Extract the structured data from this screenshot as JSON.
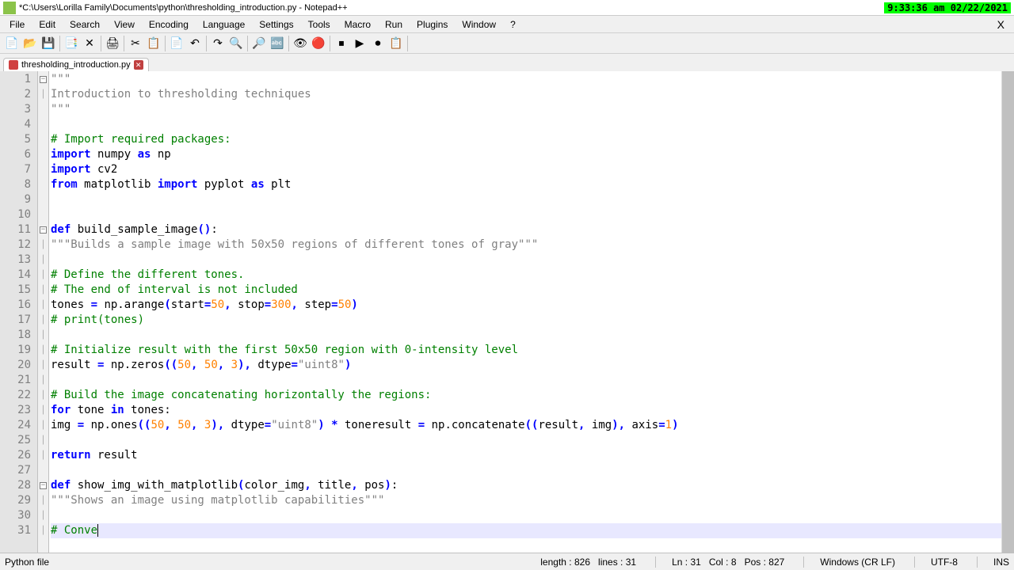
{
  "title": "*C:\\Users\\Lorilla Family\\Documents\\python\\thresholding_introduction.py - Notepad++",
  "timestamp": "9:33:36 am 02/22/2021",
  "menu": [
    "File",
    "Edit",
    "Search",
    "View",
    "Encoding",
    "Language",
    "Settings",
    "Tools",
    "Macro",
    "Run",
    "Plugins",
    "Window",
    "?"
  ],
  "close": "X",
  "tab_name": "thresholding_introduction.py",
  "code_lines": [
    {
      "n": 1,
      "fold": "box",
      "seg": [
        {
          "c": "str",
          "t": "\"\"\""
        }
      ]
    },
    {
      "n": 2,
      "fold": "line",
      "seg": [
        {
          "c": "str",
          "t": "Introduction to thresholding techniques"
        }
      ]
    },
    {
      "n": 3,
      "fold": "",
      "seg": [
        {
          "c": "str",
          "t": "\"\"\""
        }
      ]
    },
    {
      "n": 4,
      "fold": "",
      "seg": []
    },
    {
      "n": 5,
      "fold": "",
      "seg": [
        {
          "c": "cmt",
          "t": "# Import required packages:"
        }
      ]
    },
    {
      "n": 6,
      "fold": "",
      "seg": [
        {
          "c": "kw",
          "t": "import"
        },
        {
          "c": "fn",
          "t": " numpy "
        },
        {
          "c": "kw",
          "t": "as"
        },
        {
          "c": "fn",
          "t": " np"
        }
      ]
    },
    {
      "n": 7,
      "fold": "",
      "seg": [
        {
          "c": "kw",
          "t": "import"
        },
        {
          "c": "fn",
          "t": " cv2"
        }
      ]
    },
    {
      "n": 8,
      "fold": "",
      "seg": [
        {
          "c": "kw",
          "t": "from"
        },
        {
          "c": "fn",
          "t": " matplotlib "
        },
        {
          "c": "kw",
          "t": "import"
        },
        {
          "c": "fn",
          "t": " pyplot "
        },
        {
          "c": "kw",
          "t": "as"
        },
        {
          "c": "fn",
          "t": " plt"
        }
      ]
    },
    {
      "n": 9,
      "fold": "",
      "seg": []
    },
    {
      "n": 10,
      "fold": "",
      "seg": []
    },
    {
      "n": 11,
      "fold": "box",
      "seg": [
        {
          "c": "kw",
          "t": "def"
        },
        {
          "c": "fn",
          "t": " build_sample_image"
        },
        {
          "c": "kw",
          "t": "()"
        },
        {
          "c": "fn",
          "t": ":"
        }
      ]
    },
    {
      "n": 12,
      "fold": "line",
      "seg": [
        {
          "c": "str",
          "t": "\"\"\"Builds a sample image with 50x50 regions of different tones of gray\"\"\""
        }
      ]
    },
    {
      "n": 13,
      "fold": "line",
      "seg": []
    },
    {
      "n": 14,
      "fold": "line",
      "seg": [
        {
          "c": "cmt",
          "t": "# Define the different tones."
        }
      ]
    },
    {
      "n": 15,
      "fold": "line",
      "seg": [
        {
          "c": "cmt",
          "t": "# The end of interval is not included"
        }
      ]
    },
    {
      "n": 16,
      "fold": "line",
      "seg": [
        {
          "c": "fn",
          "t": "tones "
        },
        {
          "c": "kw",
          "t": "="
        },
        {
          "c": "fn",
          "t": " np.arange"
        },
        {
          "c": "kw",
          "t": "("
        },
        {
          "c": "fn",
          "t": "start"
        },
        {
          "c": "kw",
          "t": "="
        },
        {
          "c": "num",
          "t": "50"
        },
        {
          "c": "kw",
          "t": ","
        },
        {
          "c": "fn",
          "t": " stop"
        },
        {
          "c": "kw",
          "t": "="
        },
        {
          "c": "num",
          "t": "300"
        },
        {
          "c": "kw",
          "t": ","
        },
        {
          "c": "fn",
          "t": " step"
        },
        {
          "c": "kw",
          "t": "="
        },
        {
          "c": "num",
          "t": "50"
        },
        {
          "c": "kw",
          "t": ")"
        }
      ]
    },
    {
      "n": 17,
      "fold": "line",
      "seg": [
        {
          "c": "cmt",
          "t": "# print(tones)"
        }
      ]
    },
    {
      "n": 18,
      "fold": "line",
      "seg": []
    },
    {
      "n": 19,
      "fold": "line",
      "seg": [
        {
          "c": "cmt",
          "t": "# Initialize result with the first 50x50 region with 0-intensity level"
        }
      ]
    },
    {
      "n": 20,
      "fold": "line",
      "seg": [
        {
          "c": "fn",
          "t": "result "
        },
        {
          "c": "kw",
          "t": "="
        },
        {
          "c": "fn",
          "t": " np.zeros"
        },
        {
          "c": "kw",
          "t": "(("
        },
        {
          "c": "num",
          "t": "50"
        },
        {
          "c": "kw",
          "t": ","
        },
        {
          "c": "fn",
          "t": " "
        },
        {
          "c": "num",
          "t": "50"
        },
        {
          "c": "kw",
          "t": ","
        },
        {
          "c": "fn",
          "t": " "
        },
        {
          "c": "num",
          "t": "3"
        },
        {
          "c": "kw",
          "t": "),"
        },
        {
          "c": "fn",
          "t": " dtype"
        },
        {
          "c": "kw",
          "t": "="
        },
        {
          "c": "str",
          "t": "\"uint8\""
        },
        {
          "c": "kw",
          "t": ")"
        }
      ]
    },
    {
      "n": 21,
      "fold": "line",
      "seg": []
    },
    {
      "n": 22,
      "fold": "line",
      "seg": [
        {
          "c": "cmt",
          "t": "# Build the image concatenating horizontally the regions:"
        }
      ]
    },
    {
      "n": 23,
      "fold": "line",
      "seg": [
        {
          "c": "kw",
          "t": "for"
        },
        {
          "c": "fn",
          "t": " tone "
        },
        {
          "c": "kw",
          "t": "in"
        },
        {
          "c": "fn",
          "t": " tones:"
        }
      ]
    },
    {
      "n": 24,
      "fold": "line",
      "seg": [
        {
          "c": "fn",
          "t": "img "
        },
        {
          "c": "kw",
          "t": "="
        },
        {
          "c": "fn",
          "t": " np.ones"
        },
        {
          "c": "kw",
          "t": "(("
        },
        {
          "c": "num",
          "t": "50"
        },
        {
          "c": "kw",
          "t": ","
        },
        {
          "c": "fn",
          "t": " "
        },
        {
          "c": "num",
          "t": "50"
        },
        {
          "c": "kw",
          "t": ","
        },
        {
          "c": "fn",
          "t": " "
        },
        {
          "c": "num",
          "t": "3"
        },
        {
          "c": "kw",
          "t": "),"
        },
        {
          "c": "fn",
          "t": " dtype"
        },
        {
          "c": "kw",
          "t": "="
        },
        {
          "c": "str",
          "t": "\"uint8\""
        },
        {
          "c": "kw",
          "t": ")"
        },
        {
          "c": "fn",
          "t": " "
        },
        {
          "c": "kw",
          "t": "*"
        },
        {
          "c": "fn",
          "t": " toneresult "
        },
        {
          "c": "kw",
          "t": "="
        },
        {
          "c": "fn",
          "t": " np.concatenate"
        },
        {
          "c": "kw",
          "t": "(("
        },
        {
          "c": "fn",
          "t": "result"
        },
        {
          "c": "kw",
          "t": ","
        },
        {
          "c": "fn",
          "t": " img"
        },
        {
          "c": "kw",
          "t": "),"
        },
        {
          "c": "fn",
          "t": " axis"
        },
        {
          "c": "kw",
          "t": "="
        },
        {
          "c": "num",
          "t": "1"
        },
        {
          "c": "kw",
          "t": ")"
        }
      ]
    },
    {
      "n": 25,
      "fold": "line",
      "seg": []
    },
    {
      "n": 26,
      "fold": "line",
      "seg": [
        {
          "c": "kw",
          "t": "return"
        },
        {
          "c": "fn",
          "t": " result"
        }
      ]
    },
    {
      "n": 27,
      "fold": "",
      "seg": []
    },
    {
      "n": 28,
      "fold": "box",
      "seg": [
        {
          "c": "kw",
          "t": "def"
        },
        {
          "c": "fn",
          "t": " show_img_with_matplotlib"
        },
        {
          "c": "kw",
          "t": "("
        },
        {
          "c": "fn",
          "t": "color_img"
        },
        {
          "c": "kw",
          "t": ","
        },
        {
          "c": "fn",
          "t": " title"
        },
        {
          "c": "kw",
          "t": ","
        },
        {
          "c": "fn",
          "t": " pos"
        },
        {
          "c": "kw",
          "t": ")"
        },
        {
          "c": "fn",
          "t": ":"
        }
      ]
    },
    {
      "n": 29,
      "fold": "line",
      "seg": [
        {
          "c": "str",
          "t": "\"\"\"Shows an image using matplotlib capabilities\"\"\""
        }
      ]
    },
    {
      "n": 30,
      "fold": "line",
      "seg": []
    },
    {
      "n": 31,
      "fold": "line",
      "current": true,
      "seg": [
        {
          "c": "cmt",
          "t": "# Conve"
        }
      ],
      "cursor": true
    }
  ],
  "status": {
    "lang": "Python file",
    "length_label": "length :",
    "length": "826",
    "lines_label": "lines :",
    "lines": "31",
    "ln_label": "Ln :",
    "ln": "31",
    "col_label": "Col :",
    "col": "8",
    "pos_label": "Pos :",
    "pos": "827",
    "eol": "Windows (CR LF)",
    "enc": "UTF-8",
    "ins": "INS"
  },
  "toolbar_icons": [
    "📄",
    "📂",
    "💾",
    "📑",
    "✕",
    "🖨",
    "✂",
    "📋",
    "📄",
    "↶",
    "↷",
    "🔍",
    "🔎",
    "🔤",
    "👁",
    "🔴",
    "⏹",
    "▶",
    "⏺",
    "📋"
  ]
}
